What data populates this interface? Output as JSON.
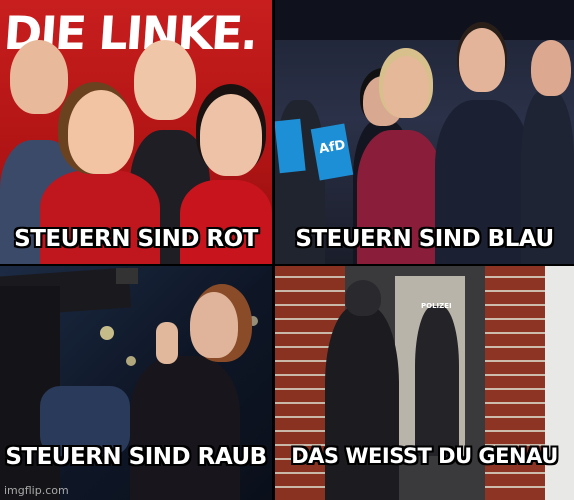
{
  "panels": {
    "top_left": {
      "logo_text": "DIE LINKE.",
      "caption": "STEUERN SIND ROT"
    },
    "top_right": {
      "flag_text": "AfD",
      "caption": "STEUERN SIND BLAU"
    },
    "bottom_left": {
      "caption": "STEUERN SIND RAUB"
    },
    "bottom_right": {
      "vest_text": "POLIZEI",
      "caption": "DAS WEISST DU GENAU"
    }
  },
  "watermark": "imgflip.com"
}
